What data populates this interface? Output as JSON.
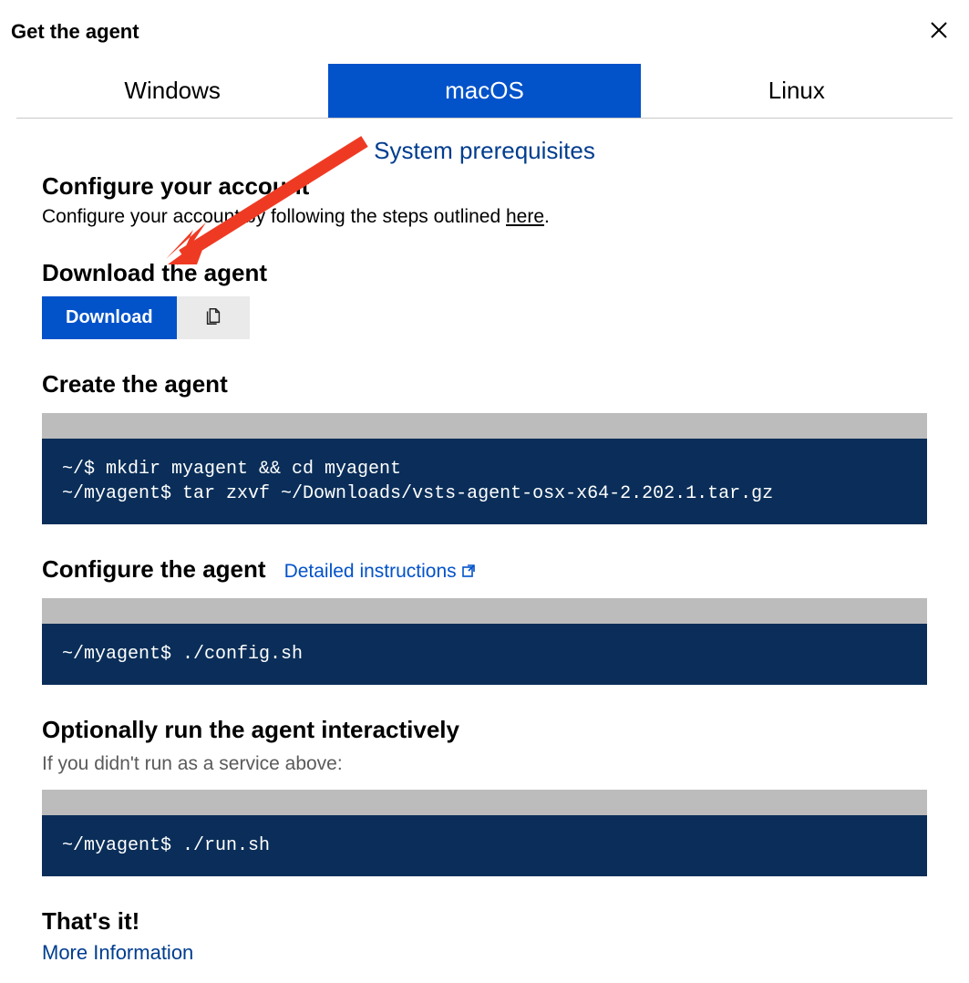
{
  "header": {
    "title": "Get the agent"
  },
  "tabs": [
    {
      "label": "Windows",
      "active": false
    },
    {
      "label": "macOS",
      "active": true
    },
    {
      "label": "Linux",
      "active": false
    }
  ],
  "prereq_link": "System prerequisites",
  "configure_account": {
    "heading": "Configure your account",
    "text_prefix": "Configure your account by following the steps outlined ",
    "link_text": "here",
    "text_suffix": "."
  },
  "download_agent": {
    "heading": "Download the agent",
    "button_label": "Download"
  },
  "create_agent": {
    "heading": "Create the agent",
    "code": "~/$ mkdir myagent && cd myagent\n~/myagent$ tar zxvf ~/Downloads/vsts-agent-osx-x64-2.202.1.tar.gz"
  },
  "configure_agent": {
    "heading": "Configure the agent",
    "detail_link": "Detailed instructions",
    "code": "~/myagent$ ./config.sh"
  },
  "run_agent": {
    "heading": "Optionally run the agent interactively",
    "subtext": "If you didn't run as a service above:",
    "code": "~/myagent$ ./run.sh"
  },
  "done": {
    "heading": "That's it!",
    "link": "More Information"
  }
}
